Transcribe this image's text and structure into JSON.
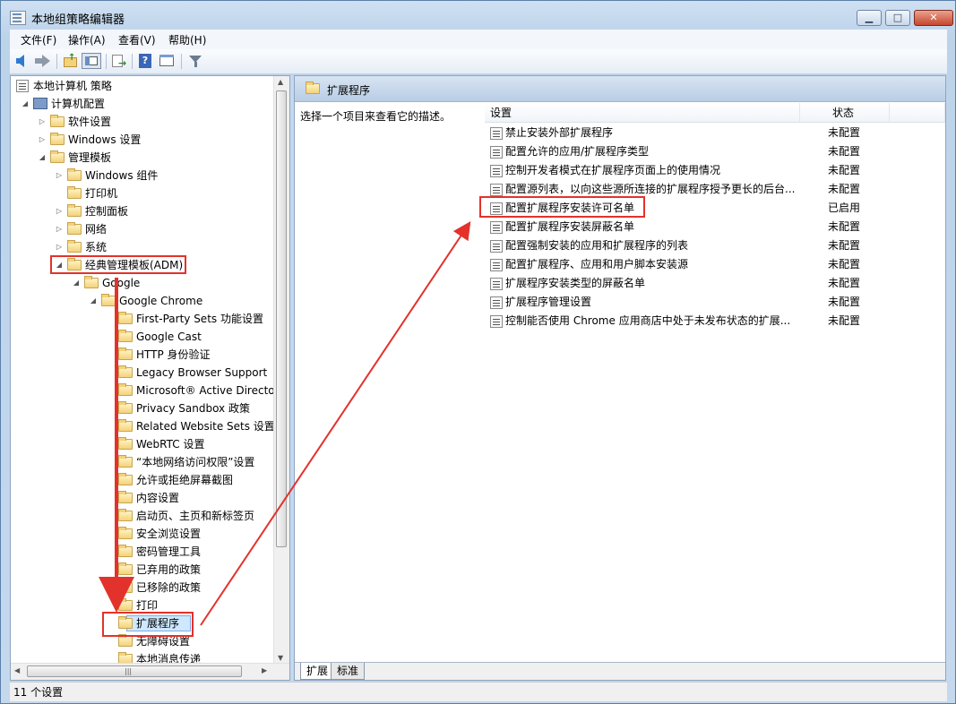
{
  "window": {
    "title": "本地组策略编辑器",
    "controls": [
      "minimize",
      "maximize",
      "close"
    ]
  },
  "menubar": {
    "items": [
      "文件(F)",
      "操作(A)",
      "查看(V)",
      "帮助(H)"
    ]
  },
  "toolbar": {
    "buttons": [
      "back-icon",
      "forward-icon",
      "up-folder-icon",
      "show-hide-tree-icon",
      "export-list-icon",
      "help-icon",
      "properties-icon",
      "filter-icon"
    ]
  },
  "tree": {
    "root": "本地计算机 策略",
    "items": [
      {
        "label": "计算机配置",
        "level": 1,
        "icon": "computer-icon",
        "expander": "expanded"
      },
      {
        "label": "软件设置",
        "level": 2,
        "icon": "folder-icon",
        "expander": "collapsed"
      },
      {
        "label": "Windows 设置",
        "level": 2,
        "icon": "folder-icon",
        "expander": "collapsed"
      },
      {
        "label": "管理模板",
        "level": 2,
        "icon": "folder-icon",
        "expander": "expanded"
      },
      {
        "label": "Windows 组件",
        "level": 3,
        "icon": "folder-icon",
        "expander": "collapsed"
      },
      {
        "label": "打印机",
        "level": 3,
        "icon": "folder-icon",
        "expander": "none"
      },
      {
        "label": "控制面板",
        "level": 3,
        "icon": "folder-icon",
        "expander": "collapsed"
      },
      {
        "label": "网络",
        "level": 3,
        "icon": "folder-icon",
        "expander": "collapsed"
      },
      {
        "label": "系统",
        "level": 3,
        "icon": "folder-icon",
        "expander": "collapsed"
      },
      {
        "label": "经典管理模板(ADM)",
        "level": 3,
        "icon": "folder-icon",
        "expander": "expanded",
        "highlighted": true
      },
      {
        "label": "Google",
        "level": 4,
        "icon": "folder-icon",
        "expander": "expanded"
      },
      {
        "label": "Google Chrome",
        "level": 5,
        "icon": "folder-icon",
        "expander": "expanded"
      },
      {
        "label": "First-Party Sets 功能设置",
        "level": 6,
        "icon": "folder-icon",
        "expander": "none"
      },
      {
        "label": "Google Cast",
        "level": 6,
        "icon": "folder-icon",
        "expander": "none"
      },
      {
        "label": "HTTP 身份验证",
        "level": 6,
        "icon": "folder-icon",
        "expander": "none"
      },
      {
        "label": "Legacy Browser Support",
        "level": 6,
        "icon": "folder-icon",
        "expander": "none"
      },
      {
        "label": "Microsoft® Active Directo",
        "level": 6,
        "icon": "folder-icon",
        "expander": "none"
      },
      {
        "label": "Privacy Sandbox 政策",
        "level": 6,
        "icon": "folder-icon",
        "expander": "none"
      },
      {
        "label": "Related Website Sets 设置",
        "level": 6,
        "icon": "folder-icon",
        "expander": "none"
      },
      {
        "label": "WebRTC 设置",
        "level": 6,
        "icon": "folder-icon",
        "expander": "none"
      },
      {
        "label": "“本地网络访问权限”设置",
        "level": 6,
        "icon": "folder-icon",
        "expander": "none"
      },
      {
        "label": "允许或拒绝屏幕截图",
        "level": 6,
        "icon": "folder-icon",
        "expander": "none"
      },
      {
        "label": "内容设置",
        "level": 6,
        "icon": "folder-icon",
        "expander": "none"
      },
      {
        "label": "启动页、主页和新标签页",
        "level": 6,
        "icon": "folder-icon",
        "expander": "none"
      },
      {
        "label": "安全浏览设置",
        "level": 6,
        "icon": "folder-icon",
        "expander": "none"
      },
      {
        "label": "密码管理工具",
        "level": 6,
        "icon": "folder-icon",
        "expander": "none"
      },
      {
        "label": "已弃用的政策",
        "level": 6,
        "icon": "folder-icon",
        "expander": "none"
      },
      {
        "label": "已移除的政策",
        "level": 6,
        "icon": "folder-icon",
        "expander": "none"
      },
      {
        "label": "打印",
        "level": 6,
        "icon": "folder-icon",
        "expander": "none"
      },
      {
        "label": "扩展程序",
        "level": 6,
        "icon": "folder-icon",
        "expander": "none",
        "selected": true,
        "highlighted": true
      },
      {
        "label": "无障碍设置",
        "level": 6,
        "icon": "folder-icon",
        "expander": "none"
      },
      {
        "label": "本地消息传递",
        "level": 6,
        "icon": "folder-icon",
        "expander": "none"
      }
    ]
  },
  "right": {
    "header_title": "扩展程序",
    "description": "选择一个项目来查看它的描述。",
    "columns": {
      "setting": "设置",
      "state": "状态"
    },
    "policies": [
      {
        "name": "禁止安装外部扩展程序",
        "state": "未配置"
      },
      {
        "name": "配置允许的应用/扩展程序类型",
        "state": "未配置"
      },
      {
        "name": "控制开发者模式在扩展程序页面上的使用情况",
        "state": "未配置"
      },
      {
        "name": "配置源列表，以向这些源所连接的扩展程序授予更长的后台...",
        "state": "未配置"
      },
      {
        "name": "配置扩展程序安装许可名单",
        "state": "已启用",
        "highlighted": true
      },
      {
        "name": "配置扩展程序安装屏蔽名单",
        "state": "未配置"
      },
      {
        "name": "配置强制安装的应用和扩展程序的列表",
        "state": "未配置"
      },
      {
        "name": "配置扩展程序、应用和用户脚本安装源",
        "state": "未配置"
      },
      {
        "name": "扩展程序安装类型的屏蔽名单",
        "state": "未配置"
      },
      {
        "name": "扩展程序管理设置",
        "state": "未配置"
      },
      {
        "name": "控制能否使用 Chrome 应用商店中处于未发布状态的扩展...",
        "state": "未配置"
      }
    ],
    "tabs": [
      {
        "label": "扩展",
        "active": true
      },
      {
        "label": "标准",
        "active": false
      }
    ]
  },
  "statusbar": {
    "text": "11 个设置"
  },
  "colors": {
    "annotation_red": "#e3322b",
    "selection_blue": "#cde8ff"
  }
}
